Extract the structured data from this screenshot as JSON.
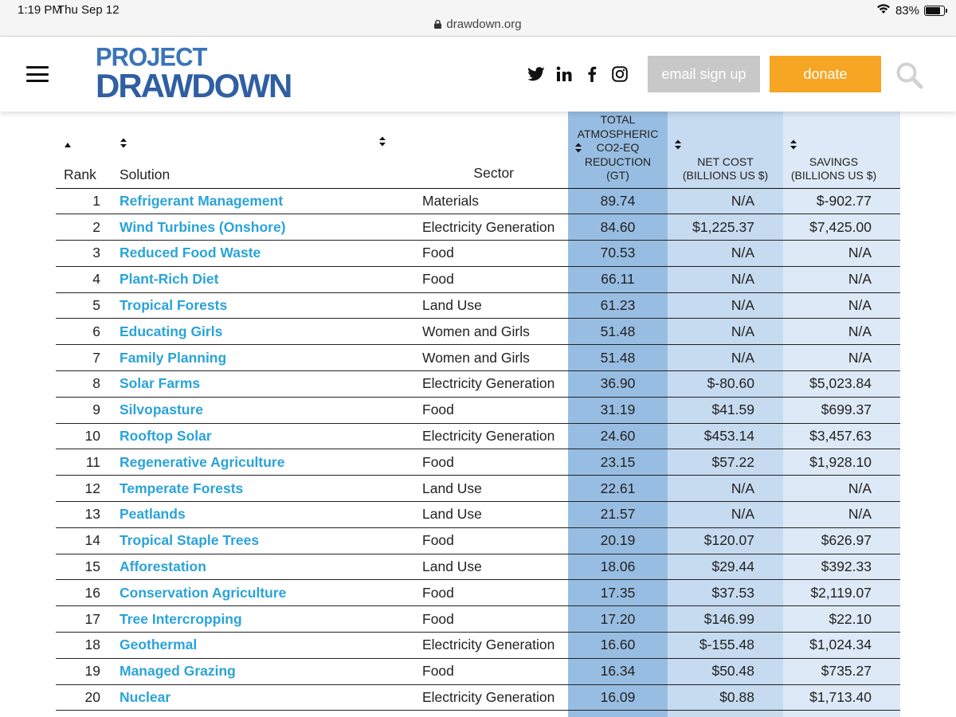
{
  "status_bar": {
    "time": "1:19 PM",
    "date": "Thu Sep 12",
    "battery": "83%",
    "url": "drawdown.org"
  },
  "header": {
    "logo_line1": "PROJECT",
    "logo_line2": "DRAWDOWN",
    "email_label": "email sign up",
    "donate_label": "donate",
    "social_icons": [
      "twitter-icon",
      "linkedin-icon",
      "facebook-icon",
      "instagram-icon"
    ],
    "colors": {
      "email_button": "#c8c8c8",
      "donate_button": "#f6a623",
      "logo": "#3b74b8",
      "link": "#2aa3d8"
    }
  },
  "table": {
    "headers": {
      "rank": "Rank",
      "solution": "Solution",
      "sector": "Sector",
      "total_l1": "TOTAL",
      "total_l2": "ATMOSPHERIC",
      "total_l3": "CO2-EQ",
      "total_l4": "REDUCTION",
      "total_l5": "(GT)",
      "net_l1": "NET COST",
      "net_l2": "(BILLIONS US $)",
      "sav_l1": "SAVINGS",
      "sav_l2": "(BILLIONS US $)"
    },
    "rows": [
      {
        "rank": "1",
        "solution": "Refrigerant Management",
        "sector": "Materials",
        "total": "89.74",
        "net_cost": "N/A",
        "savings": "$-902.77"
      },
      {
        "rank": "2",
        "solution": "Wind Turbines (Onshore)",
        "sector": "Electricity Generation",
        "total": "84.60",
        "net_cost": "$1,225.37",
        "savings": "$7,425.00"
      },
      {
        "rank": "3",
        "solution": "Reduced Food Waste",
        "sector": "Food",
        "total": "70.53",
        "net_cost": "N/A",
        "savings": "N/A"
      },
      {
        "rank": "4",
        "solution": "Plant-Rich Diet",
        "sector": "Food",
        "total": "66.11",
        "net_cost": "N/A",
        "savings": "N/A"
      },
      {
        "rank": "5",
        "solution": "Tropical Forests",
        "sector": "Land Use",
        "total": "61.23",
        "net_cost": "N/A",
        "savings": "N/A"
      },
      {
        "rank": "6",
        "solution": "Educating Girls",
        "sector": "Women and Girls",
        "total": "51.48",
        "net_cost": "N/A",
        "savings": "N/A"
      },
      {
        "rank": "7",
        "solution": "Family Planning",
        "sector": "Women and Girls",
        "total": "51.48",
        "net_cost": "N/A",
        "savings": "N/A"
      },
      {
        "rank": "8",
        "solution": "Solar Farms",
        "sector": "Electricity Generation",
        "total": "36.90",
        "net_cost": "$-80.60",
        "savings": "$5,023.84"
      },
      {
        "rank": "9",
        "solution": "Silvopasture",
        "sector": "Food",
        "total": "31.19",
        "net_cost": "$41.59",
        "savings": "$699.37"
      },
      {
        "rank": "10",
        "solution": "Rooftop Solar",
        "sector": "Electricity Generation",
        "total": "24.60",
        "net_cost": "$453.14",
        "savings": "$3,457.63"
      },
      {
        "rank": "11",
        "solution": "Regenerative Agriculture",
        "sector": "Food",
        "total": "23.15",
        "net_cost": "$57.22",
        "savings": "$1,928.10"
      },
      {
        "rank": "12",
        "solution": "Temperate Forests",
        "sector": "Land Use",
        "total": "22.61",
        "net_cost": "N/A",
        "savings": "N/A"
      },
      {
        "rank": "13",
        "solution": "Peatlands",
        "sector": "Land Use",
        "total": "21.57",
        "net_cost": "N/A",
        "savings": "N/A"
      },
      {
        "rank": "14",
        "solution": "Tropical Staple Trees",
        "sector": "Food",
        "total": "20.19",
        "net_cost": "$120.07",
        "savings": "$626.97"
      },
      {
        "rank": "15",
        "solution": "Afforestation",
        "sector": "Land Use",
        "total": "18.06",
        "net_cost": "$29.44",
        "savings": "$392.33"
      },
      {
        "rank": "16",
        "solution": "Conservation Agriculture",
        "sector": "Food",
        "total": "17.35",
        "net_cost": "$37.53",
        "savings": "$2,119.07"
      },
      {
        "rank": "17",
        "solution": "Tree Intercropping",
        "sector": "Food",
        "total": "17.20",
        "net_cost": "$146.99",
        "savings": "$22.10"
      },
      {
        "rank": "18",
        "solution": "Geothermal",
        "sector": "Electricity Generation",
        "total": "16.60",
        "net_cost": "$-155.48",
        "savings": "$1,024.34"
      },
      {
        "rank": "19",
        "solution": "Managed Grazing",
        "sector": "Food",
        "total": "16.34",
        "net_cost": "$50.48",
        "savings": "$735.27"
      },
      {
        "rank": "20",
        "solution": "Nuclear",
        "sector": "Electricity Generation",
        "total": "16.09",
        "net_cost": "$0.88",
        "savings": "$1,713.40"
      }
    ]
  }
}
